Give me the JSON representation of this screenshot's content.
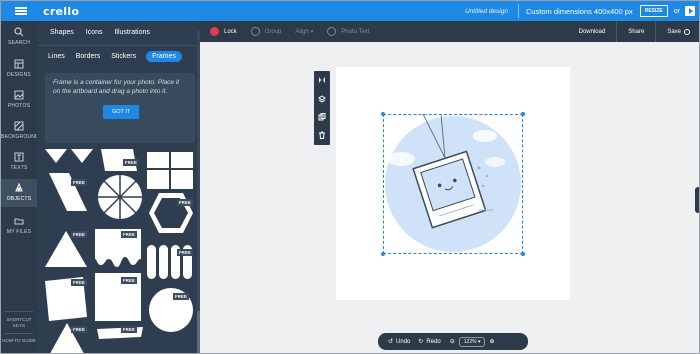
{
  "app": {
    "logo": "crello"
  },
  "topbar": {
    "design_name": "Untitled design",
    "dimensions": "Custom dimensions 400x400 px",
    "resize_label": "RESIZE",
    "or_label": "or"
  },
  "rail": {
    "items": [
      {
        "label": "SEARCH",
        "icon": "search-icon"
      },
      {
        "label": "DESIGNS",
        "icon": "designs-icon"
      },
      {
        "label": "PHOTOS",
        "icon": "photos-icon"
      },
      {
        "label": "BACKGROUND",
        "icon": "background-icon"
      },
      {
        "label": "TEXTS",
        "icon": "texts-icon"
      },
      {
        "label": "OBJECTS",
        "icon": "objects-icon",
        "active": true
      },
      {
        "label": "MY FILES",
        "icon": "folder-icon"
      }
    ],
    "bottom": [
      {
        "label": "SHORTCUT KEYS"
      },
      {
        "label": "HOW-TO GUIDE"
      }
    ]
  },
  "panel": {
    "tabs": [
      "Shapes",
      "Icons",
      "Illustrations"
    ],
    "subtabs": [
      "Lines",
      "Borders",
      "Stickers",
      "Frames"
    ],
    "active_subtab": "Frames",
    "info_text": "Frame is a container for your photo. Place it on the artboard and drag a photo into it.",
    "gotit_label": "GOT IT",
    "free_badge": "FREE"
  },
  "toolbar": {
    "lock": "Lock",
    "group": "Group",
    "align": "Align",
    "photo_text": "Photo Text",
    "download": "Download",
    "share": "Share",
    "save": "Save"
  },
  "bottom": {
    "undo": "Undo",
    "redo": "Redo",
    "zoom": "122%"
  },
  "colors": {
    "accent": "#1e88e5",
    "sidebar": "#2c3a4a",
    "panel": "#2e3e50",
    "lock_red": "#e53950",
    "illustration_blue": "#cfe2f7"
  }
}
